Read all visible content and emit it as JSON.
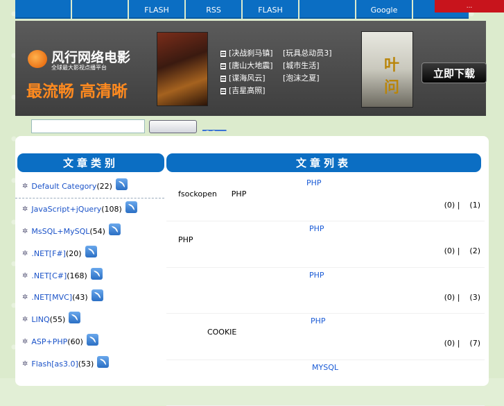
{
  "nav": {
    "items": [
      "",
      "",
      "FLASH",
      "RSS",
      "FLASH",
      "",
      "Google",
      ""
    ],
    "red_label": "..."
  },
  "banner": {
    "logo_title": "风行网络电影",
    "logo_sub": "全球最大影视点播平台",
    "slogan": "最流畅 高清晰",
    "movies_left": [
      "[决战刹马镇]",
      "[唐山大地震]",
      "[谍海风云]",
      "[吉星高照]"
    ],
    "movies_right": [
      "[玩具总动员3]",
      "[城市生活]",
      "[泡沫之夏]"
    ],
    "poster2_text": "叶问",
    "download_label": "立即下载"
  },
  "search": {
    "value": "",
    "button_label": "",
    "links": "_ _ ___"
  },
  "sidebar": {
    "heading": "文章类别",
    "categories": [
      {
        "name": "Default Category",
        "count": "(22)"
      },
      {
        "name": "JavaScript+jQuery",
        "count": "(108)"
      },
      {
        "name": "MsSQL+MySQL",
        "count": "(54)"
      },
      {
        "name": ".NET[F#]",
        "count": "(20)"
      },
      {
        "name": ".NET[C#]",
        "count": "(168)"
      },
      {
        "name": ".NET[MVC]",
        "count": "(43)"
      },
      {
        "name": "LINQ",
        "count": "(55)"
      },
      {
        "name": "ASP+PHP",
        "count": "(60)"
      },
      {
        "name": "Flash[as3.0]",
        "count": "(53)"
      }
    ]
  },
  "articles": {
    "heading": "文章列表",
    "items": [
      {
        "title": "PHP",
        "snippet": "fsockopen      PHP",
        "stats": "(0) |    (1)"
      },
      {
        "title": "PHP",
        "snippet": "PHP",
        "stats": "(0) |    (2)"
      },
      {
        "title": "PHP",
        "snippet": "",
        "stats": "(0) |    (3)"
      },
      {
        "title": "PHP",
        "snippet": "            COOKIE",
        "stats": "(0) |    (7)"
      },
      {
        "title": "MYSQL",
        "snippet": "",
        "stats": ""
      }
    ]
  }
}
